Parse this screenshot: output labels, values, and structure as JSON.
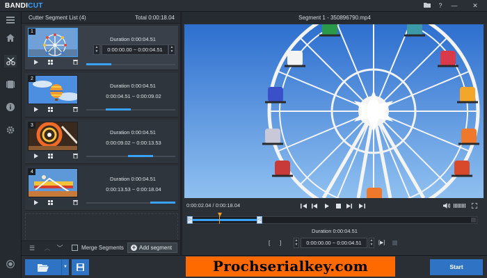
{
  "app": {
    "logo_part1": "BANDI",
    "logo_part2": "CUT"
  },
  "titlebar": {
    "icons": [
      "folder-icon",
      "help-icon",
      "minimize-icon",
      "close-icon"
    ],
    "help_glyph": "?",
    "minimize_glyph": "—",
    "close_glyph": "✕"
  },
  "sidebar": {
    "items": [
      "home-icon",
      "cut-icon",
      "film-icon",
      "info-icon",
      "settings-icon"
    ],
    "bottom": "record-icon"
  },
  "segment_list": {
    "title": "Cutter Segment List (4)",
    "total_label": "Total",
    "total_time": "0:00:18.04",
    "segments": [
      {
        "number": "1",
        "duration": "Duration 0:00:04.51",
        "range": "0:00:00.00 ~ 0:00:04.51",
        "progress": 0.25,
        "selected": true
      },
      {
        "number": "2",
        "duration": "Duration 0:00:04.51",
        "range": "0:00:04.51 ~ 0:00:09.02",
        "progress": 0.5
      },
      {
        "number": "3",
        "duration": "Duration 0:00:04.51",
        "range": "0:00:09.02 ~ 0:00:13.53",
        "progress": 0.75
      },
      {
        "number": "4",
        "duration": "Duration 0:00:04.51",
        "range": "0:00:13.53 ~ 0:00:18.04",
        "progress": 1.0
      }
    ],
    "footer": {
      "merge_label": "Merge Segments",
      "merge_checked": false,
      "add_segment_label": "Add segment"
    }
  },
  "preview": {
    "title": "Segment 1 - 350896790.mp4",
    "current_time": "0:00:02.04 / 0:00:18.04",
    "duration": "Duration 0:00:04.51",
    "range": "0:00:00.00 ~ 0:00:04.51",
    "start_bracket": "[",
    "end_bracket": "]",
    "play_selection_glyph": "[▶]",
    "selection_end_fraction": 0.25,
    "playhead_fraction": 0.113,
    "volume_level": 0.9
  },
  "bottombar": {
    "start_label": "Start",
    "watermark": "Prochserialkey.com"
  },
  "colors": {
    "accent": "#2f74c4",
    "progress": "#3aa3ff",
    "watermark_bg": "#ff6a00"
  }
}
